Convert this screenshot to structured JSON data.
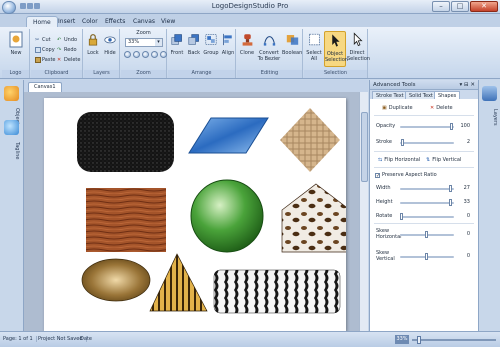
{
  "window": {
    "title": "LogoDesignStudio Pro"
  },
  "window_controls": {
    "minimize": "–",
    "maximize": "□",
    "close": "✕"
  },
  "ribbon_tabs": [
    "Home",
    "Insert",
    "Color",
    "Effects",
    "Canvas",
    "View"
  ],
  "ribbon": {
    "logo": {
      "label": "Logo",
      "new": "New"
    },
    "clipboard": {
      "label": "Clipboard",
      "cut": "Cut",
      "copy": "Copy",
      "paste": "Paste",
      "undo": "Undo",
      "redo": "Redo",
      "delete": "Delete"
    },
    "layers": {
      "label": "Layers",
      "lock": "Lock",
      "hide": "Hide"
    },
    "zoom": {
      "label": "Zoom",
      "title": "Zoom",
      "value": "33%"
    },
    "arrange": {
      "label": "Arrange",
      "front": "Front",
      "back": "Back",
      "group": "Group",
      "align": "Align"
    },
    "editing": {
      "label": "Editing",
      "clone": "Clone",
      "convert": "Convert To Bezier",
      "boolean": "Boolean"
    },
    "selection": {
      "label": "Selection",
      "select_all": "Select All",
      "object_selection": "Object Selection",
      "direct_selection": "Direct Selection"
    }
  },
  "left_sidebar": {
    "objects": "Objects",
    "tagline": "Tagline"
  },
  "document_tabs": [
    "Canvas1"
  ],
  "right_sidebar": {
    "layers": "Layers"
  },
  "advanced_tools": {
    "title": "Advanced Tools",
    "title_controls": "▾ ⊟ ✕",
    "tabs": [
      "Stroke Text",
      "Solid Text",
      "Shapes"
    ],
    "duplicate": "Duplicate",
    "delete": "Delete",
    "opacity_label": "Opacity",
    "opacity_value": "100",
    "opacity_fraction": 1.0,
    "stroke_label": "Stroke",
    "stroke_value": "2",
    "stroke_fraction": 0.05,
    "flip_horizontal": "Flip Horizontal",
    "flip_vertical": "Flip Vertical",
    "preserve_aspect": "Preserve Aspect Ratio",
    "preserve_checked": "✓",
    "width_label": "Width",
    "width_value": "27",
    "width_fraction": 0.95,
    "height_label": "Height",
    "height_value": "33",
    "height_fraction": 0.95,
    "rotate_label": "Rotate",
    "rotate_value": "0",
    "rotate_fraction": 0.0,
    "skew_h_label": "Skew Horizontal",
    "skew_h_value": "0",
    "skew_h_fraction": 0.5,
    "skew_v_label": "Skew Vertical",
    "skew_v_value": "0",
    "skew_v_fraction": 0.5
  },
  "status": {
    "page": "Page: 1 of 1",
    "project": "Project Not Saved",
    "date": "Date",
    "zoom": "33%",
    "zoom_fraction": 0.08
  },
  "colors": {
    "accent": "#2f66b3",
    "ribbon_bg": "#d4e1f1",
    "canvas_bg": "#aebcd0"
  }
}
